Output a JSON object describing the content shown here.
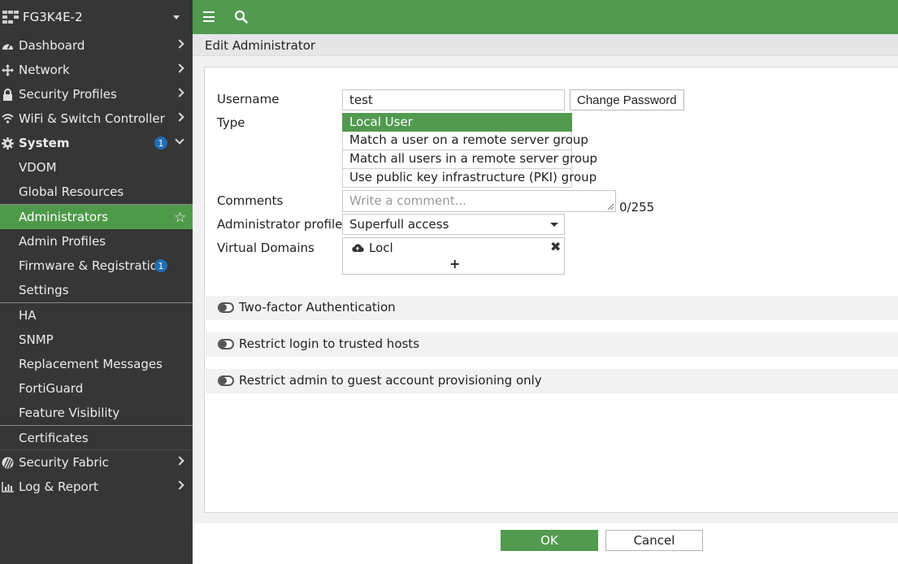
{
  "sidebar": {
    "hostname": "FG3K4E-2",
    "items": [
      {
        "label": "Dashboard"
      },
      {
        "label": "Network"
      },
      {
        "label": "Security Profiles"
      },
      {
        "label": "WiFi & Switch Controller"
      },
      {
        "label": "System",
        "badge": "1"
      },
      {
        "label": "VDOM"
      },
      {
        "label": "Global Resources"
      },
      {
        "label": "Administrators"
      },
      {
        "label": "Admin Profiles"
      },
      {
        "label": "Firmware & Registration",
        "badge": "1"
      },
      {
        "label": "Settings"
      },
      {
        "label": "HA"
      },
      {
        "label": "SNMP"
      },
      {
        "label": "Replacement Messages"
      },
      {
        "label": "FortiGuard"
      },
      {
        "label": "Feature Visibility"
      },
      {
        "label": "Certificates"
      },
      {
        "label": "Security Fabric"
      },
      {
        "label": "Log & Report"
      }
    ]
  },
  "page": {
    "title": "Edit Administrator"
  },
  "form": {
    "username_label": "Username",
    "username_value": "test",
    "change_password": "Change Password",
    "type_label": "Type",
    "type_options": [
      "Local User",
      "Match a user on a remote server group",
      "Match all users in a remote server group",
      "Use public key infrastructure (PKI) group"
    ],
    "comments_label": "Comments",
    "comments_placeholder": "Write a comment...",
    "comments_counter": "0/255",
    "profile_label": "Administrator profile",
    "profile_value": "Superfull access",
    "vdom_label": "Virtual Domains",
    "vdom_entry": "Locl",
    "vdom_add": "+",
    "toggles": [
      {
        "label": "Two-factor Authentication",
        "on": false
      },
      {
        "label": "Restrict login to trusted hosts",
        "on": false
      },
      {
        "label": "Restrict admin to guest account provisioning only",
        "on": false
      }
    ]
  },
  "footer": {
    "ok": "OK",
    "cancel": "Cancel"
  },
  "colors": {
    "accent": "#519a4f",
    "sidebar_bg": "#363636",
    "badge": "#1f6fb5"
  }
}
